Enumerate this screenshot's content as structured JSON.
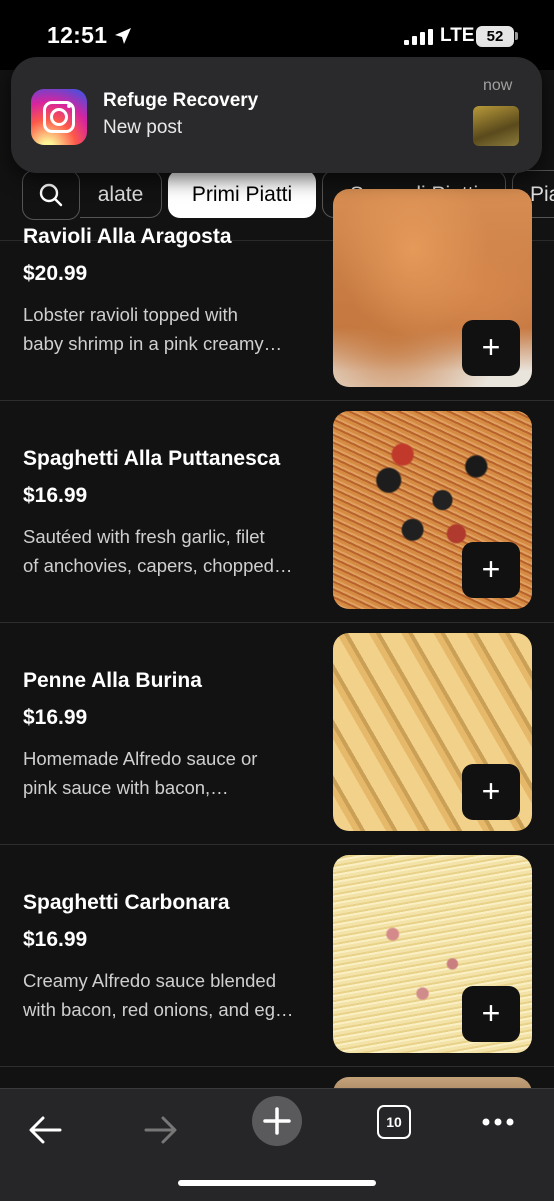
{
  "status_bar": {
    "time": "12:51",
    "network": "LTE",
    "battery": "52"
  },
  "notification": {
    "app_icon": "instagram-icon",
    "title": "Refuge Recovery",
    "body": "New post",
    "time": "now",
    "thumb_text": "REFUGE RECOVERY Corbett, OR"
  },
  "categories": {
    "search_icon": "search-icon",
    "tabs": [
      {
        "label": "alate",
        "active": false
      },
      {
        "label": "Primi Piatti",
        "active": true
      },
      {
        "label": "Secondi Piatti",
        "active": false
      },
      {
        "label": "Pia",
        "active": false
      }
    ]
  },
  "menu": {
    "items": [
      {
        "name": "Ravioli Alla Aragosta",
        "price": "$20.99",
        "desc_line1": "Lobster ravioli topped with",
        "desc_line2": "baby shrimp in a pink creamy…"
      },
      {
        "name": "Spaghetti Alla Puttanesca",
        "price": "$16.99",
        "desc_line1": "Sautéed with fresh garlic, filet",
        "desc_line2": "of anchovies, capers, chopped…"
      },
      {
        "name": "Penne Alla Burina",
        "price": "$16.99",
        "desc_line1": "Homemade Alfredo sauce or",
        "desc_line2": "pink sauce with bacon,…"
      },
      {
        "name": "Spaghetti Carbonara",
        "price": "$16.99",
        "desc_line1": "Creamy Alfredo sauce blended",
        "desc_line2": "with bacon, red onions, and eg…"
      }
    ],
    "add_label": "+"
  },
  "browser_bar": {
    "back_icon": "arrow-left-icon",
    "forward_icon": "arrow-right-icon",
    "new_tab_icon": "plus-icon",
    "tab_count": "10",
    "more_icon": "more-icon"
  }
}
